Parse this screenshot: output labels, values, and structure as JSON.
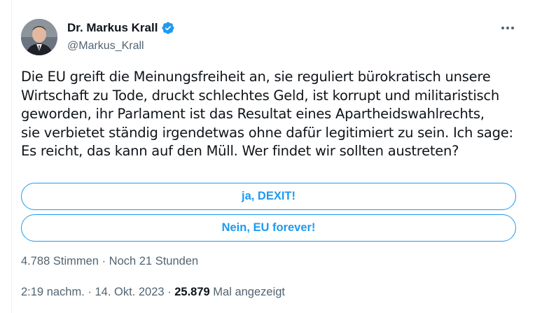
{
  "author": {
    "display_name": "Dr. Markus Krall",
    "handle": "@Markus_Krall",
    "verified": true
  },
  "icons": {
    "verified": "verified-badge-icon",
    "more": "more-horizontal-icon",
    "avatar": "profile-photo"
  },
  "tweet": {
    "text": "Die EU greift die Meinungsfreiheit an, sie reguliert bürokratisch unsere\nWirtschaft zu Tode, druckt schlechtes Geld, ist korrupt und militaristisch\ngeworden, ihr Parlament ist das Resultat eines Apartheidswahlrechts,\nsie verbietet ständig irgendetwas ohne dafür legitimiert zu sein. Ich sage:\nEs reicht, das kann auf den Müll. Wer findet wir sollten austreten?"
  },
  "poll": {
    "options": [
      {
        "label": "ja, DEXIT!"
      },
      {
        "label": "Nein, EU forever!"
      }
    ],
    "votes": "4.788 Stimmen",
    "separator": " · ",
    "remaining": "Noch 21 Stunden"
  },
  "meta": {
    "time": "2:19 nachm.",
    "sep1": " · ",
    "date": "14. Okt. 2023",
    "sep2": " · ",
    "views_count": "25.879",
    "views_label": " Mal angezeigt"
  },
  "colors": {
    "accent": "#1d9bf0",
    "text": "#0f1419",
    "muted": "#536471"
  }
}
